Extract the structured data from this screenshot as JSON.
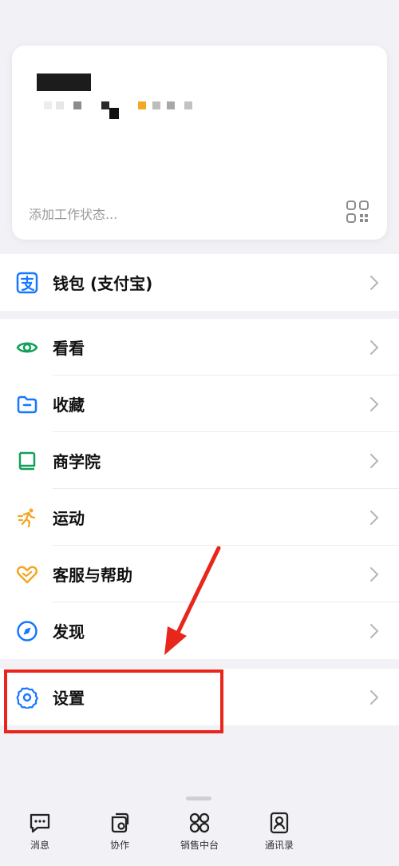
{
  "profile": {
    "status_placeholder": "添加工作状态..."
  },
  "wallet": {
    "label": "钱包 (支付宝)"
  },
  "menu": {
    "items": [
      {
        "label": "看看",
        "icon": "eye-icon"
      },
      {
        "label": "收藏",
        "icon": "folder-icon"
      },
      {
        "label": "商学院",
        "icon": "book-icon"
      },
      {
        "label": "运动",
        "icon": "running-icon"
      },
      {
        "label": "客服与帮助",
        "icon": "heart-hands-icon"
      },
      {
        "label": "发现",
        "icon": "compass-icon"
      }
    ]
  },
  "settings": {
    "label": "设置",
    "icon": "gear-icon"
  },
  "tabbar": {
    "tabs": [
      {
        "label": "消息",
        "icon": "message-icon"
      },
      {
        "label": "协作",
        "icon": "collab-icon"
      },
      {
        "label": "销售中台",
        "icon": "grid-apps-icon"
      },
      {
        "label": "通讯录",
        "icon": "contacts-icon"
      }
    ]
  },
  "colors": {
    "accent_blue": "#1677ff",
    "green": "#12a05a",
    "orange": "#f5a623",
    "annotation_red": "#e8261c"
  }
}
